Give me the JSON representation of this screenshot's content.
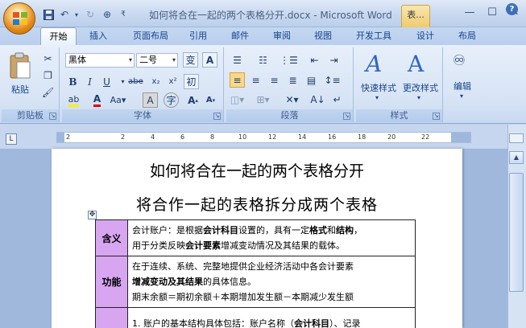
{
  "window": {
    "title": "如何将合在一起的两个表格分开.docx - Microsoft Word",
    "context_tab": "表...",
    "minimize": "—",
    "maximize": "☐",
    "close": "✕"
  },
  "tabs": [
    "开始",
    "插入",
    "页面布局",
    "引用",
    "邮件",
    "审阅",
    "视图",
    "开发工具",
    "设计",
    "布局"
  ],
  "active_tab": "开始",
  "ribbon": {
    "clipboard": {
      "paste": "粘贴",
      "label": "剪贴板"
    },
    "font": {
      "font_name": "黑体",
      "font_size": "二号",
      "label": "字体"
    },
    "paragraph": {
      "label": "段落"
    },
    "styles": {
      "quick_styles": "快速样式",
      "change_styles": "更改样式",
      "label": "样式"
    },
    "editing": {
      "label": "编辑"
    }
  },
  "ruler": {
    "numbers": [
      "2",
      "2",
      "4",
      "6",
      "8",
      "10",
      "12",
      "14",
      "16",
      "18",
      "20",
      "22"
    ]
  },
  "document": {
    "title1": "如何将合在一起的两个表格分开",
    "title2": "将合作一起的表格拆分成两个表格",
    "table_handle": "✥",
    "rows": [
      {
        "head": "含义",
        "lines": [
          [
            {
              "t": "会计账户：是根据",
              "b": false
            },
            {
              "t": "会计科目",
              "b": true
            },
            {
              "t": "设置的，具有一定",
              "b": false
            },
            {
              "t": "格式",
              "b": true
            },
            {
              "t": "和",
              "b": false
            },
            {
              "t": "结构",
              "b": true
            },
            {
              "t": "，",
              "b": false
            }
          ],
          [
            {
              "t": "用于分类反映",
              "b": false
            },
            {
              "t": "会计要素",
              "b": true
            },
            {
              "t": "增减变动情况及其结果的载体。",
              "b": false
            }
          ]
        ]
      },
      {
        "head": "功能",
        "lines": [
          [
            {
              "t": "在于连续、系统、完整地提供企业经济活动中各会计要素",
              "b": false
            }
          ],
          [
            {
              "t": "增减变动及其结果",
              "b": true
            },
            {
              "t": "的具体信息。",
              "b": false
            }
          ],
          [
            {
              "t": "期末余额＝期初余额＋本期增加发生额－本期减少发生额",
              "b": false
            }
          ]
        ]
      },
      {
        "head": "",
        "lines": [
          [
            {
              "t": "1. 账户的基本结构具体包括：账户名称（",
              "b": false
            },
            {
              "t": "会计科目",
              "b": true
            },
            {
              "t": "）、记录",
              "b": false
            }
          ]
        ]
      }
    ]
  },
  "colors": {
    "table_head_bg": "#d8a6f1",
    "ribbon_bg": "#dce7f6",
    "accent": "#15428b"
  }
}
